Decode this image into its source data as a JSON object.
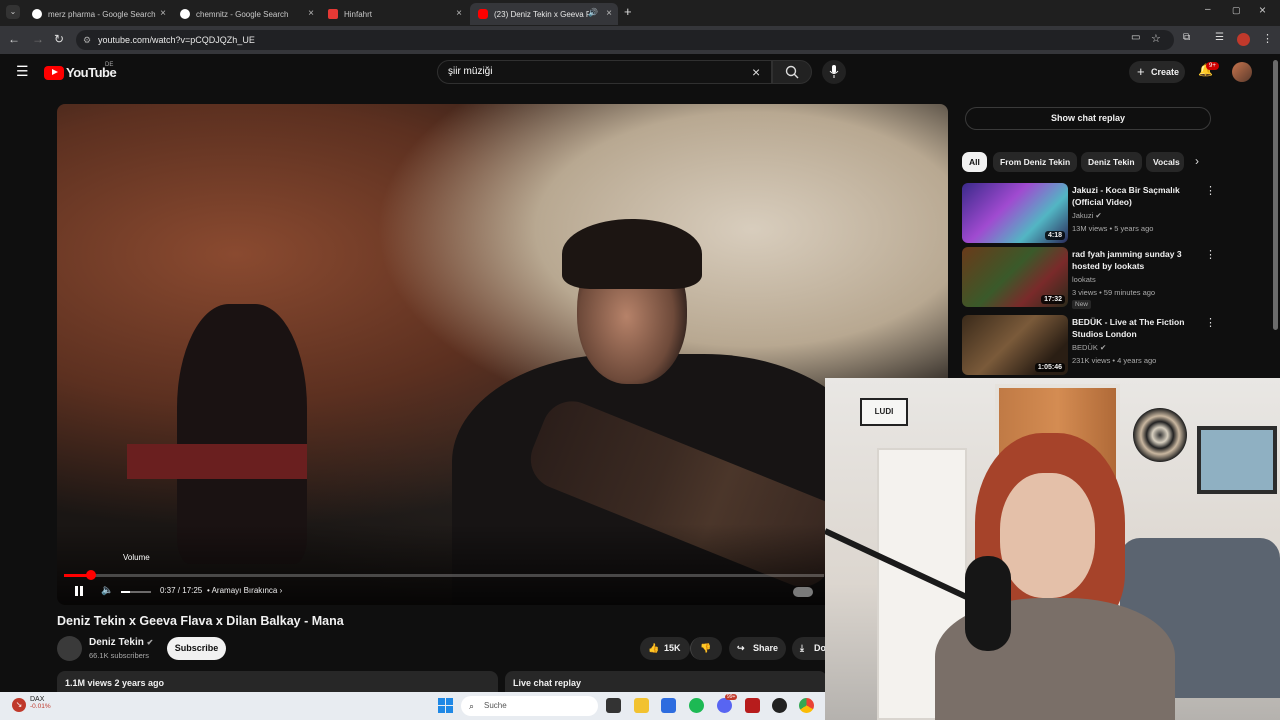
{
  "browser": {
    "tabs": [
      {
        "label": "merz pharma - Google Search",
        "active": false
      },
      {
        "label": "chemnitz - Google Search",
        "active": false
      },
      {
        "label": "Hinfahrt",
        "active": false
      },
      {
        "label": "(23) Deniz Tekin x Geeva Fla",
        "active": true
      }
    ],
    "url": "youtube.com/watch?v=pCQDJQZh_UE"
  },
  "header": {
    "logo_text": "YouTube",
    "country_code": "DE",
    "search_value": "şiir müziği",
    "create_label": "Create",
    "notification_count": "9+"
  },
  "player": {
    "volume_tooltip": "Volume",
    "time_text": "0:37 / 17:25",
    "chapter_text": "• Aramayı Bırakınca",
    "chapter_chevron": "›",
    "progress_fraction": 0.035,
    "volume_fraction": 0.3
  },
  "video": {
    "title": "Deniz Tekin x Geeva Flava x Dilan Balkay - Mana",
    "channel": "Deniz Tekin",
    "subscribers": "66.1K subscribers",
    "subscribe_label": "Subscribe",
    "likes": "15K",
    "share_label": "Share",
    "download_label_partial": "Do",
    "views_age": "1.1M views  2 years ago",
    "live_chat_replay": "Live chat replay"
  },
  "sidebar": {
    "show_chat_replay": "Show chat replay",
    "chips": [
      "All",
      "From Deniz Tekin",
      "Deniz Tekin",
      "Vocals"
    ],
    "recommendations": [
      {
        "title": "Jakuzi - Koca Bir Saçmalık (Official Video)",
        "channel": "Jakuzi",
        "verified": true,
        "meta": "13M views • 5 years ago",
        "duration": "4:18",
        "badge": ""
      },
      {
        "title": "rad fyah jamming sunday 3 hosted by lookats",
        "channel": "lookats",
        "verified": false,
        "meta": "3 views • 59 minutes ago",
        "duration": "17:32",
        "badge": "New"
      },
      {
        "title": "BEDÜK - Live at The Fiction Studios London",
        "channel": "BEDÜK",
        "verified": true,
        "meta": "231K views • 4 years ago",
        "duration": "1:05:46",
        "badge": ""
      }
    ]
  },
  "webcam": {
    "sign_text": "LUDI"
  },
  "taskbar": {
    "ticker_name": "DAX",
    "ticker_change": "-0.01%",
    "search_placeholder": "Suche",
    "mail_badge": "99+"
  },
  "colors": {
    "yt_red": "#ff0000",
    "background": "#0f0f0f",
    "chip_bg": "#272727"
  }
}
